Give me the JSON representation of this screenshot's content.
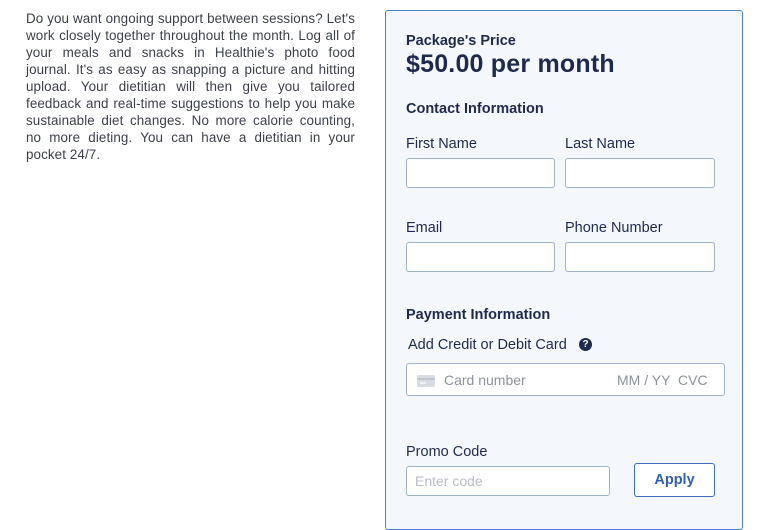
{
  "description": "Do you want ongoing support between sessions? Let's work closely together throughout the month. Log all of your meals and snacks in Healthie's photo food journal. It's as easy as snapping a picture and hitting upload. Your dietitian will then give you tailored feedback and real-time suggestions to help you make sustainable diet changes. No more calorie counting, no more dieting. You can have a dietitian in your pocket 24/7.",
  "package": {
    "price_label": "Package's Price",
    "price_value": "$50.00 per month"
  },
  "contact": {
    "title": "Contact Information",
    "first_name_label": "First Name",
    "first_name_value": "",
    "last_name_label": "Last Name",
    "last_name_value": "",
    "email_label": "Email",
    "email_value": "",
    "phone_label": "Phone Number",
    "phone_value": ""
  },
  "payment": {
    "title": "Payment Information",
    "card_label": "Add Credit or Debit Card",
    "help_glyph": "?",
    "card_number_placeholder": "Card number",
    "expiry_placeholder": "MM / YY",
    "cvc_placeholder": "CVC"
  },
  "promo": {
    "label": "Promo Code",
    "placeholder": "Enter code",
    "apply_label": "Apply"
  },
  "colors": {
    "panel_border": "#4a7fd4",
    "panel_background": "#f4f7fc",
    "heading_text": "#1d2a4d",
    "apply_accent": "#2f5fb3"
  },
  "icons": {
    "card": "credit-card-icon",
    "help": "help-circle-icon"
  }
}
